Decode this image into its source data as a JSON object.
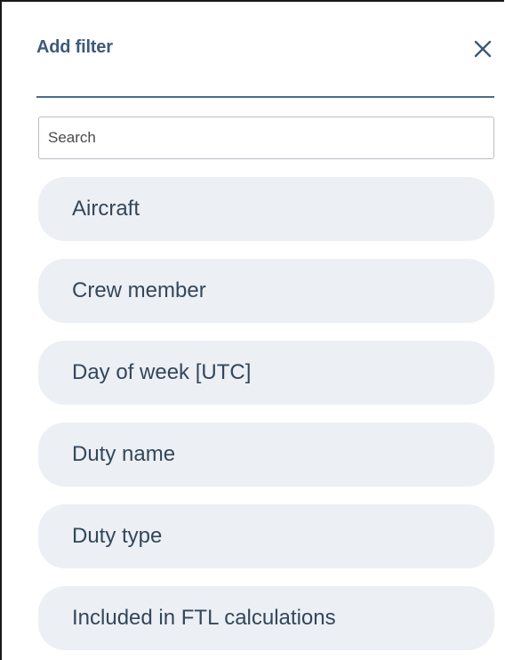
{
  "panel": {
    "title": "Add filter",
    "close_icon": "close-icon"
  },
  "search": {
    "placeholder": "Search",
    "value": ""
  },
  "filters": [
    {
      "label": "Aircraft"
    },
    {
      "label": "Crew member"
    },
    {
      "label": "Day of week [UTC]"
    },
    {
      "label": "Duty name"
    },
    {
      "label": "Duty type"
    },
    {
      "label": "Included in FTL calculations"
    }
  ],
  "colors": {
    "title": "#3d5a7a",
    "divider": "#4d6b8a",
    "item_background": "#eceff4",
    "item_text": "#33475b"
  }
}
